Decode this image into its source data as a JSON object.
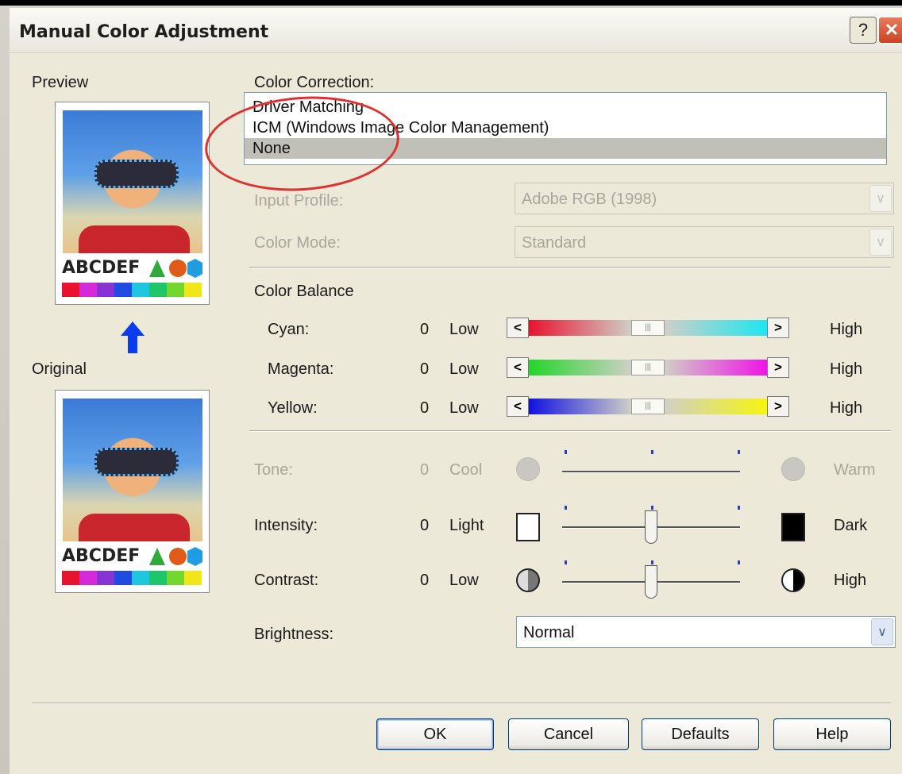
{
  "window": {
    "title": "Manual Color Adjustment",
    "help_glyph": "?",
    "close_glyph": "✕"
  },
  "left": {
    "preview_label": "Preview",
    "original_label": "Original",
    "thumb_text": "ABCDEF",
    "swatch_colors": [
      "#e8132e",
      "#d52ad9",
      "#8a33d4",
      "#1f4be0",
      "#1ec7e0",
      "#1ec66a",
      "#72d82e",
      "#f0e618"
    ]
  },
  "color_correction": {
    "label": "Color Correction:",
    "options": [
      "Driver Matching",
      "ICM (Windows Image Color Management)",
      "None"
    ],
    "selected": "None"
  },
  "input_profile": {
    "label": "Input Profile:",
    "value": "Adobe RGB (1998)"
  },
  "color_mode": {
    "label": "Color Mode:",
    "value": "Standard"
  },
  "color_balance": {
    "label": "Color Balance",
    "rows": [
      {
        "name": "Cyan:",
        "value": "0",
        "low": "Low",
        "high": "High",
        "left_color": "#e8132e",
        "right_color": "#1ee6f0",
        "level": 0.5
      },
      {
        "name": "Magenta:",
        "value": "0",
        "low": "Low",
        "high": "High",
        "left_color": "#22d62a",
        "right_color": "#f014e6",
        "level": 0.5
      },
      {
        "name": "Yellow:",
        "value": "0",
        "low": "Low",
        "high": "High",
        "left_color": "#1212e0",
        "right_color": "#f5f510",
        "level": 0.5
      }
    ]
  },
  "tone": {
    "label": "Tone:",
    "value": "0",
    "low": "Cool",
    "high": "Warm"
  },
  "intensity": {
    "label": "Intensity:",
    "value": "0",
    "low": "Light",
    "high": "Dark",
    "level": 0.5
  },
  "contrast": {
    "label": "Contrast:",
    "value": "0",
    "low": "Low",
    "high": "High",
    "level": 0.5
  },
  "brightness": {
    "label": "Brightness:",
    "value": "Normal"
  },
  "buttons": {
    "ok": "OK",
    "cancel": "Cancel",
    "defaults": "Defaults",
    "help": "Help"
  }
}
